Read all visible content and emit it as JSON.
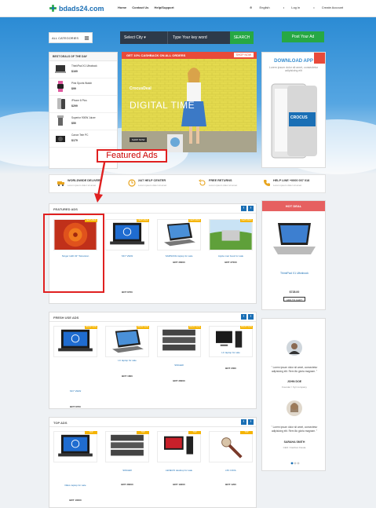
{
  "header": {
    "logo": "bdads24.com",
    "nav": [
      "Home",
      "Contact Us",
      "Help/Support"
    ],
    "language": "English",
    "login": "Log in",
    "create_account": "Create Account"
  },
  "search": {
    "categories_label": "ALL CATEGORIES",
    "city_label": "Select City",
    "keyword_placeholder": "Type Your key word",
    "search_button": "SEARCH",
    "post_ad": "Post Your Ad"
  },
  "top_offer": {
    "title": "BEST DEALS OF THE DAY",
    "items": [
      {
        "name": "ThinkPad X1 Ultrabook",
        "price": "$169"
      },
      {
        "name": "Pink Sports Watch",
        "price": "$99"
      },
      {
        "name": "iPhone 6 Plus",
        "price": "$299"
      },
      {
        "name": "Superior 900W Juicer",
        "price": "$50"
      },
      {
        "name": "Canon Tele PC",
        "price": "$179"
      }
    ]
  },
  "banner": {
    "strip_text": "GET 10% CASHBACK ON ALL ORDERS",
    "shop_now": "SHOP NOW",
    "tag": "CrocusDeal",
    "title": "DIGITAL TIME",
    "more": "SHOP NOW"
  },
  "app_promo": {
    "title": "DOWNLOAD APP",
    "subtitle": "Lorem ipsum dolor sit amet, consectetur adipisicing elit",
    "brand": "CROCUS"
  },
  "callout": "Featured Ads",
  "features": [
    {
      "title": "WORLDWIDE DELIVERY",
      "desc": "Lorem ipsum dolor sit amet"
    },
    {
      "title": "24/7 HELP CENTER",
      "desc": "Lorem ipsum dolor sit amet"
    },
    {
      "title": "FREE RETURNS",
      "desc": "Lorem ipsum dolor sit amet"
    },
    {
      "title": "HELP LINE +0000 007 018",
      "desc": "Lorem ipsum dolor sit amet"
    }
  ],
  "featured_ads": {
    "title": "FEATURED ADS",
    "badge": "FEATURED",
    "items": [
      {
        "name": "Singer LED 32\" Television",
        "price": "BDT 130000"
      },
      {
        "name": "SKY VIEW",
        "price": "BDT 8700"
      },
      {
        "name": "SAMSUNG laptop for sale",
        "price": "BDT 28000"
      },
      {
        "name": "Apple mac book for sale",
        "price": "BDT 27000"
      }
    ]
  },
  "fresh_ads": {
    "title": "FRESH USE ADS",
    "badge": "FRESH ADS",
    "items": [
      {
        "name": "SKY VIEW",
        "price": "BDT 8700"
      },
      {
        "name": "LC laptop for sale",
        "price": "BDT 1800"
      },
      {
        "name": "SINGER",
        "price": "BDT 28000"
      },
      {
        "name": "LC laptop for sale",
        "price": "BDT 2000"
      }
    ]
  },
  "top_ads": {
    "title": "TOP ADS",
    "badge": "TOP",
    "items": [
      {
        "name": "DELL laptop for sale",
        "price": "BDT 10000"
      },
      {
        "name": "SINGER",
        "price": "BDT 28000"
      },
      {
        "name": "LENEVO desktop for sale",
        "price": "BDT 19000"
      },
      {
        "name": "JJK COOL",
        "price": "BDT 1200"
      }
    ]
  },
  "hot_deal": {
    "title": "HOT DEAL",
    "name": "ThinkPad X1 Ultrabook",
    "price": "$728.00",
    "button": "ADD TO CART"
  },
  "testimonials": [
    {
      "quote": "\" Lorem ipsum dolor sit amet, consectetur adipisicing elit. Rem illo gloria magnam. \"",
      "name": "JOHN DOE",
      "role": "Founder / Xyz company"
    },
    {
      "quote": "\" Lorem ipsum dolor sit amet, consectetur adipisicing elit. Rem illo gloria magnam. \"",
      "name": "SARAHA SMITH",
      "role": "CEO / Fashion Fiesta"
    }
  ]
}
